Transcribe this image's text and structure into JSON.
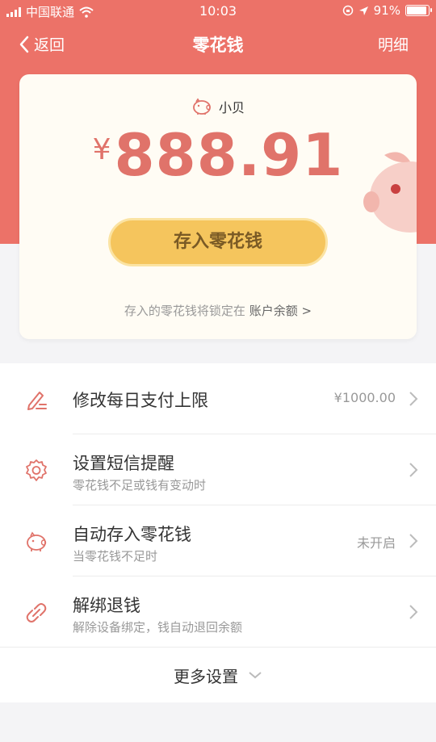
{
  "status_bar": {
    "carrier": "中国联通",
    "time": "10:03",
    "battery": "91%"
  },
  "nav": {
    "back_label": "返回",
    "title": "零花钱",
    "right_label": "明细"
  },
  "card": {
    "owner_name": "小贝",
    "currency": "¥",
    "amount": "888.91",
    "deposit_button": "存入零花钱",
    "note_prefix": "存入的零花钱将锁定在",
    "note_link": "账户余额 >"
  },
  "settings": [
    {
      "title": "修改每日支付上限",
      "subtitle": "",
      "value": "¥1000.00",
      "icon": "edit-icon"
    },
    {
      "title": "设置短信提醒",
      "subtitle": "零花钱不足或钱有变动时",
      "value": "",
      "icon": "gear-icon"
    },
    {
      "title": "自动存入零花钱",
      "subtitle": "当零花钱不足时",
      "value": "未开启",
      "icon": "piggy-bank-icon"
    },
    {
      "title": "解绑退钱",
      "subtitle": "解除设备绑定，钱自动退回余额",
      "value": "",
      "icon": "link-icon"
    }
  ],
  "more_label": "更多设置",
  "colors": {
    "accent": "#ec7268",
    "button": "#f5c55d",
    "amount": "#e0736a"
  }
}
